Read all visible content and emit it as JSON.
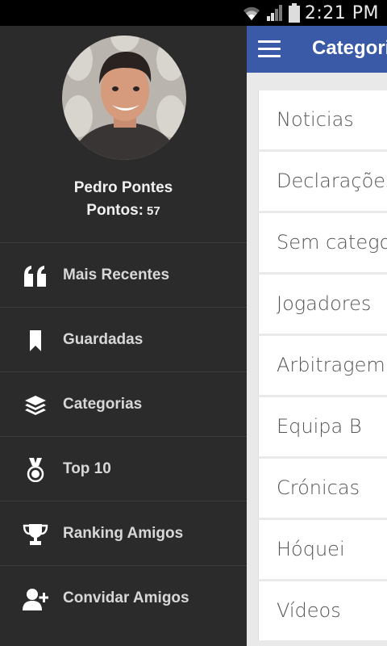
{
  "status_bar": {
    "time": "2:21 PM"
  },
  "appbar": {
    "title": "Categorias"
  },
  "categories": [
    "Noticias",
    "Declarações",
    "Sem categoria",
    "Jogadores",
    "Arbitragem",
    "Equipa B",
    "Crónicas",
    "Hóquei",
    "Vídeos"
  ],
  "profile": {
    "name": "Pedro Pontes",
    "points_label": "Pontos:",
    "points_value": "57"
  },
  "menu": [
    {
      "label": "Mais Recentes",
      "icon": "quote-icon"
    },
    {
      "label": "Guardadas",
      "icon": "bookmark-icon"
    },
    {
      "label": "Categorias",
      "icon": "layers-icon"
    },
    {
      "label": "Top 10",
      "icon": "medal-icon"
    },
    {
      "label": "Ranking Amigos",
      "icon": "trophy-icon"
    },
    {
      "label": "Convidar Amigos",
      "icon": "add-user-icon"
    }
  ],
  "colors": {
    "appbar": "#3a5aa8",
    "drawer": "#2b2b2b",
    "list_bg": "#e9e9e9"
  }
}
